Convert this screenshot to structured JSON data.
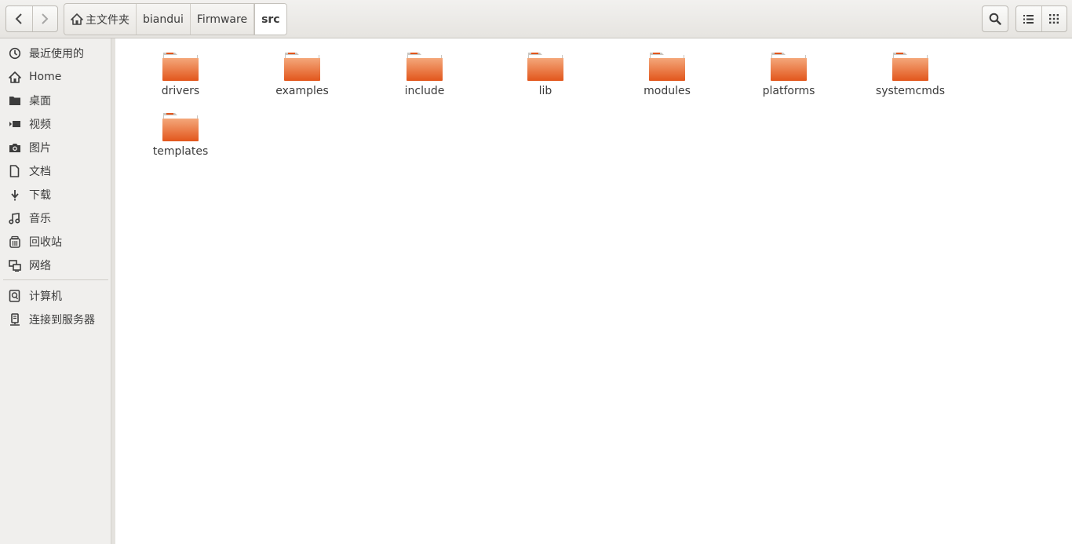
{
  "headerbar": {
    "back_icon": "chevron-left-icon",
    "forward_icon": "chevron-right-icon",
    "breadcrumbs": [
      {
        "label": "主文件夹",
        "icon": "home-icon"
      },
      {
        "label": "biandui"
      },
      {
        "label": "Firmware"
      },
      {
        "label": "src",
        "active": true
      }
    ],
    "search_icon": "search-icon",
    "list_view_icon": "list-view-icon",
    "grid_view_icon": "grid-view-icon"
  },
  "sidebar": {
    "items": [
      {
        "label": "最近使用的",
        "icon": "recent-icon"
      },
      {
        "label": "Home",
        "icon": "home-icon"
      },
      {
        "label": "桌面",
        "icon": "desktop-icon"
      },
      {
        "label": "视频",
        "icon": "video-icon"
      },
      {
        "label": "图片",
        "icon": "camera-icon"
      },
      {
        "label": "文档",
        "icon": "document-icon"
      },
      {
        "label": "下载",
        "icon": "download-icon"
      },
      {
        "label": "音乐",
        "icon": "music-icon"
      },
      {
        "label": "回收站",
        "icon": "trash-icon"
      },
      {
        "label": "网络",
        "icon": "network-icon"
      }
    ],
    "devices": [
      {
        "label": "计算机",
        "icon": "computer-icon"
      },
      {
        "label": "连接到服务器",
        "icon": "server-icon"
      }
    ]
  },
  "files": [
    {
      "name": "drivers",
      "type": "folder"
    },
    {
      "name": "examples",
      "type": "folder"
    },
    {
      "name": "include",
      "type": "folder"
    },
    {
      "name": "lib",
      "type": "folder"
    },
    {
      "name": "modules",
      "type": "folder"
    },
    {
      "name": "platforms",
      "type": "folder"
    },
    {
      "name": "systemcmds",
      "type": "folder"
    },
    {
      "name": "templates",
      "type": "folder"
    }
  ],
  "colors": {
    "folder_top": "#f4a77a",
    "folder_bottom": "#e2561c",
    "accent": "#e95420"
  }
}
